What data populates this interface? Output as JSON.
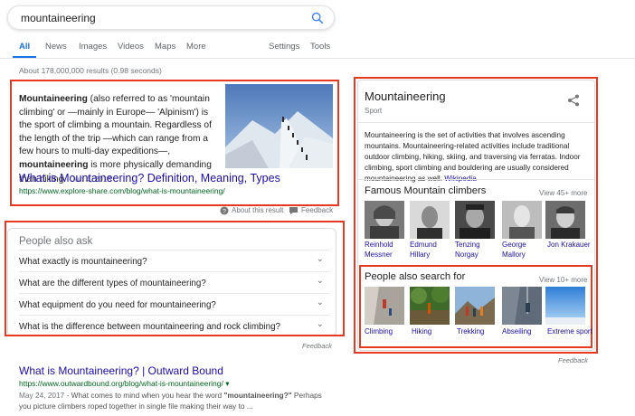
{
  "search": {
    "query": "mountaineering"
  },
  "tabs": [
    {
      "label": "All"
    },
    {
      "label": "News"
    },
    {
      "label": "Images"
    },
    {
      "label": "Videos"
    },
    {
      "label": "Maps"
    },
    {
      "label": "More"
    },
    {
      "label": "Settings"
    },
    {
      "label": "Tools"
    }
  ],
  "result_stats": "About 178,000,000 results (0.98 seconds)",
  "featured_snippet": {
    "term": "Mountaineering",
    "text_a": " (also referred to as 'mountain climbing' or —mainly in Europe— 'Alpinism') is the sport of climbing a mountain. Regardless of the length of the trip —which can range from a few hours to multi-day expeditions—, ",
    "bold_b": "mountaineering",
    "text_c": " is more physically demanding than hiking.",
    "date": "Jun 4, 2018",
    "title": "What is Mountaineering? Definition, Meaning, Types",
    "url": "https://www.explore-share.com/blog/what-is-mountaineering/",
    "about": "About this result",
    "feedback": "Feedback"
  },
  "paa": {
    "heading": "People also ask",
    "questions": [
      "What exactly is mountaineering?",
      "What are the different types of mountaineering?",
      "What equipment do you need for mountaineering?",
      "What is the difference between mountaineering and rock climbing?"
    ],
    "feedback": "Feedback"
  },
  "organic": {
    "title": "What is Mountaineering? | Outward Bound",
    "url": "https://www.outwardbound.org/blog/what-is-mountaineering/",
    "url_arrow": "▾",
    "date": "May 24, 2017 - ",
    "snip_a": "What comes to mind when you hear the word ",
    "snip_bold": "\"mountaineering?\"",
    "snip_b": " Perhaps you picture climbers roped together in single file making their way to ..."
  },
  "knowledge_panel": {
    "title": "Mountaineering",
    "subtitle": "Sport",
    "description": "Mountaineering is the set of activities that involves ascending mountains. Mountaineering-related activities include traditional outdoor climbing, hiking, skiing, and traversing via ferratas. Indoor climbing, sport climbing and bouldering are usually considered mountaineering as well. ",
    "desc_link": "Wikipedia",
    "climbers_title": "Famous Mountain climbers",
    "climbers_more": "View 45+ more",
    "climbers": [
      {
        "name": "Reinhold Messner"
      },
      {
        "name": "Edmund Hillary"
      },
      {
        "name": "Tenzing Norgay"
      },
      {
        "name": "George Mallory"
      },
      {
        "name": "Jon Krakauer"
      }
    ],
    "also_title": "People also search for",
    "also_more": "View 10+ more",
    "also": [
      {
        "name": "Climbing"
      },
      {
        "name": "Hiking"
      },
      {
        "name": "Trekking"
      },
      {
        "name": "Abseiling"
      },
      {
        "name": "Extreme sport"
      }
    ],
    "feedback": "Feedback"
  },
  "colors": {
    "accent": "#1a73e8",
    "link": "#1a0dab",
    "url": "#006621",
    "highlight_box": "#e8381f"
  }
}
